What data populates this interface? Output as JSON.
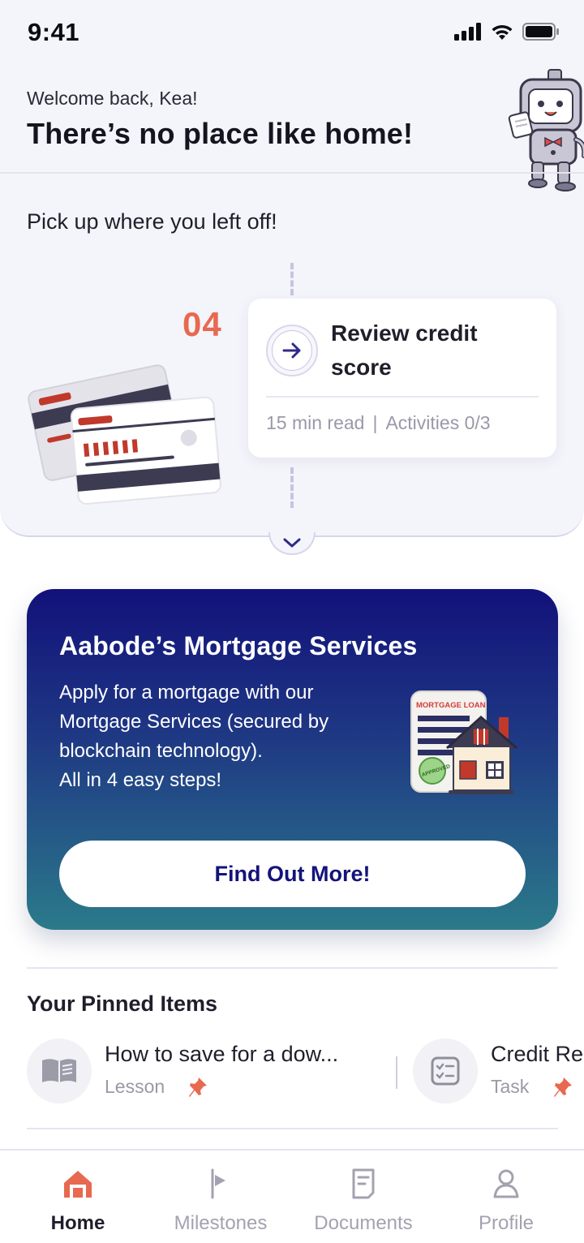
{
  "status_bar": {
    "time": "9:41"
  },
  "header": {
    "welcome": "Welcome back, Kea!",
    "headline": "There’s no place like home!"
  },
  "progress": {
    "section_title": "Pick up where you left off!",
    "step_number": "04",
    "lesson": {
      "title": "Review credit score",
      "read_time": "15 min read",
      "separator": "|",
      "activities": "Activities 0/3"
    }
  },
  "promo": {
    "title": "Aabode’s Mortgage Services",
    "body_line1": "Apply for a mortgage with our Mortgage Services (secured by blockchain technology).",
    "body_line2": "All in 4 easy steps!",
    "illustration_label": "MORTGAGE LOAN",
    "stamp_label": "APPROVED",
    "button_label": "Find Out More!"
  },
  "pinned": {
    "title": "Your Pinned Items",
    "items": [
      {
        "title": "How to save for a dow...",
        "type": "Lesson",
        "icon": "book-icon"
      },
      {
        "title": "Credit Re",
        "type": "Task",
        "icon": "checklist-icon"
      }
    ]
  },
  "bottom_nav": {
    "items": [
      {
        "label": "Home",
        "icon": "home-icon",
        "active": true
      },
      {
        "label": "Milestones",
        "icon": "flag-icon",
        "active": false
      },
      {
        "label": "Documents",
        "icon": "document-icon",
        "active": false
      },
      {
        "label": "Profile",
        "icon": "profile-icon",
        "active": false
      }
    ]
  },
  "colors": {
    "accent": "#e8694f",
    "brand_navy": "#14137a",
    "promo_gradient_start": "#12117a",
    "promo_gradient_end": "#2b7a8a",
    "muted_text": "#9a99a8"
  }
}
